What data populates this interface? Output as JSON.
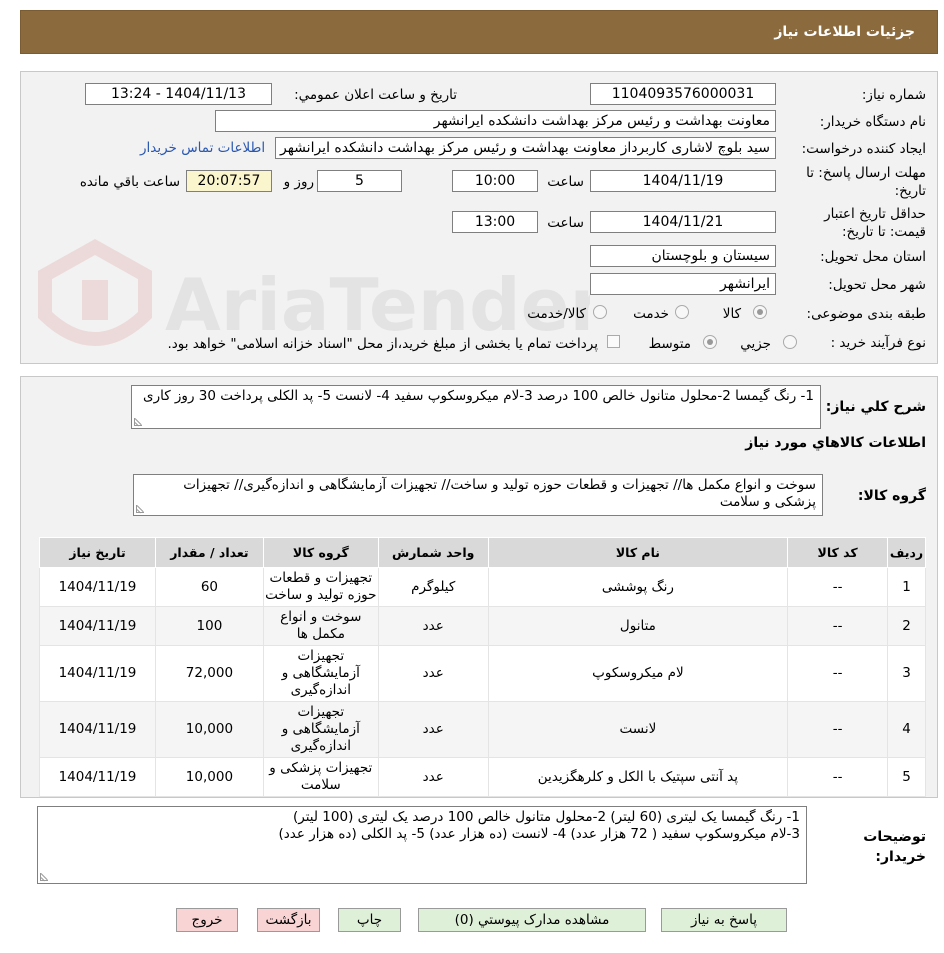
{
  "header": {
    "title": "جزئیات اطلاعات نیاز"
  },
  "watermark": {
    "text": "AriaTender.neT"
  },
  "form": {
    "need_number_label": "شماره نیاز:",
    "need_number": "1104093576000031",
    "announce_label": "تاریخ و ساعت اعلان عمومي:",
    "announce_value": "1404/11/13 - 13:24",
    "buyer_org_label": "نام دستگاه خريدار:",
    "buyer_org": "معاونت بهداشت و رئیس مرکز بهداشت دانشکده ایرانشهر",
    "requester_label": "ايجاد کننده درخواست:",
    "requester": "سید بلوچ لاشاری کاربرداز معاونت بهداشت و رئیس مرکز بهداشت دانشکده ایرانشهر",
    "contact_link": "اطلاعات تماس خريدار",
    "deadline_label": "مهلت ارسال پاسخ: تا تاريخ:",
    "deadline_date": "1404/11/19",
    "time_label": "ساعت",
    "deadline_time": "10:00",
    "days_value": "5",
    "days_label": "روز و",
    "remaining_value": "20:07:57",
    "remaining_label": "ساعت باقي مانده",
    "validity_label": "حداقل تاريخ اعتبار قيمت: تا تاريخ:",
    "validity_date": "1404/11/21",
    "validity_time": "13:00",
    "province_label": "استان محل تحويل:",
    "province": "سيستان و بلوچستان",
    "city_label": "شهر محل تحويل:",
    "city": "ايرانشهر",
    "category_label": "طبقه بندی موضوعی:",
    "category_options": [
      "کالا",
      "خدمت",
      "کالا/خدمت"
    ],
    "category_selected": "کالا",
    "process_label": "نوع فرآيند خريد :",
    "process_options": [
      "جزيي",
      "متوسط"
    ],
    "process_selected": "متوسط",
    "payment_note": "پرداخت تمام يا بخشی از مبلغ خريد،از محل \"اسناد خزانه اسلامی\" خواهد بود."
  },
  "summary": {
    "label": "شرح كلي نياز:",
    "text": "1- رنگ گیمسا  2-محلول متانول خالص 100 درصد  3-لام میکروسکوپ سفید  4- لانست  5- پد الکلی پرداخت 30 روز کاری"
  },
  "goods_info": {
    "title": "اطلاعات کالاهاي مورد نياز",
    "group_label": "گروه کالا:",
    "group_text": "سوخت و انواع مکمل ها// تجهیزات و قطعات حوزه تولید و ساخت// تجهیزات آزمایشگاهی و اندازه‌گیری// تجهیزات پزشکی و سلامت"
  },
  "table": {
    "headers": [
      "رديف",
      "کد کالا",
      "نام کالا",
      "واحد شمارش",
      "گروه کالا",
      "تعداد / مقدار",
      "تاريخ نياز"
    ],
    "rows": [
      {
        "row": "1",
        "code": "--",
        "name": "رنگ پوششی",
        "unit": "کیلوگرم",
        "group": "تجهیزات و قطعات حوزه تولید و ساخت",
        "qty": "60",
        "date": "1404/11/19"
      },
      {
        "row": "2",
        "code": "--",
        "name": "متانول",
        "unit": "عدد",
        "group": "سوخت و انواع مکمل ها",
        "qty": "100",
        "date": "1404/11/19"
      },
      {
        "row": "3",
        "code": "--",
        "name": "لام میکروسکوپ",
        "unit": "عدد",
        "group": "تجهیزات آزمایشگاهی و اندازه‌گیری",
        "qty": "72,000",
        "date": "1404/11/19"
      },
      {
        "row": "4",
        "code": "--",
        "name": "لانست",
        "unit": "عدد",
        "group": "تجهیزات آزمایشگاهی و اندازه‌گیری",
        "qty": "10,000",
        "date": "1404/11/19"
      },
      {
        "row": "5",
        "code": "--",
        "name": "پد آنتی سپتیک با الکل و کلرهگزیدین",
        "unit": "عدد",
        "group": "تجهیزات پزشکی و سلامت",
        "qty": "10,000",
        "date": "1404/11/19"
      }
    ]
  },
  "buyer_notes": {
    "label": "توضيحات خريدار:",
    "line1": "1- رنگ گیمسا یک لیتری (60 لیتر)    2-محلول متانول خالص 100 درصد یک لیتری (100 لیتر)",
    "line2": "3-لام میکروسکوپ سفید ( 72 هزار عدد)    4- لانست (ده هزار عدد)     5- پد الکلی (ده هزار عدد)"
  },
  "buttons": {
    "reply": "پاسخ به نياز",
    "attachments": "مشاهده مدارک پيوستي (0)",
    "print": "چاپ",
    "back": "بازگشت",
    "exit": "خروج"
  }
}
